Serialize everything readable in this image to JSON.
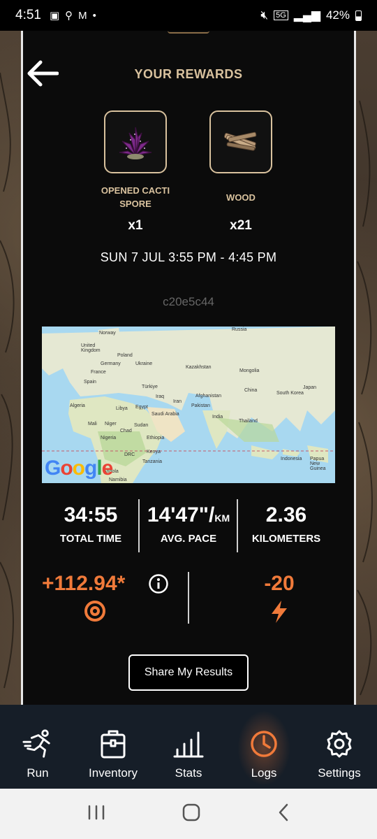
{
  "status_bar": {
    "time": "4:51",
    "battery": "42%",
    "network": "5G"
  },
  "header": {
    "title": "YOUR REWARDS"
  },
  "rewards": [
    {
      "name_line1": "OPENED CACTI",
      "name_line2": "SPORE",
      "quantity": "x1",
      "icon": "cacti-spore-icon"
    },
    {
      "name_line1": "WOOD",
      "name_line2": "",
      "quantity": "x21",
      "icon": "wood-icon"
    }
  ],
  "session": {
    "date_range": "SUN 7 JUL 3:55 PM - 4:45 PM",
    "id": "c20e5c44"
  },
  "map": {
    "labels": [
      "Russia",
      "Norway",
      "United Kingdom",
      "Poland",
      "Germany",
      "Ukraine",
      "France",
      "Spain",
      "Kazakhstan",
      "Mongolia",
      "Türkiye",
      "Iraq",
      "Iran",
      "Afghanistan",
      "Pakistan",
      "China",
      "South Korea",
      "Japan",
      "Algeria",
      "Libya",
      "Egypt",
      "Saudi Arabia",
      "India",
      "Thailand",
      "Mali",
      "Niger",
      "Chad",
      "Sudan",
      "Nigeria",
      "Ethiopia",
      "DRC",
      "Kenya",
      "Tanzania",
      "Angola",
      "Namibia",
      "Indonesia",
      "Papua New Guinea"
    ],
    "attribution": "Google"
  },
  "stats": {
    "total_time": {
      "value": "34:55",
      "label": "TOTAL TIME"
    },
    "avg_pace": {
      "value": "14'47\"/",
      "unit": "KM",
      "label": "AVG. PACE"
    },
    "distance": {
      "value": "2.36",
      "label": "KILOMETERS"
    }
  },
  "score": {
    "points": "+112.94*",
    "energy": "-20"
  },
  "share_button": "Share My Results",
  "nav": {
    "items": [
      {
        "label": "Run",
        "icon": "runner-icon"
      },
      {
        "label": "Inventory",
        "icon": "chest-icon"
      },
      {
        "label": "Stats",
        "icon": "bar-chart-icon"
      },
      {
        "label": "Logs",
        "icon": "clock-icon",
        "active": true
      },
      {
        "label": "Settings",
        "icon": "gear-icon"
      }
    ]
  },
  "colors": {
    "accent": "#f07a3a",
    "gold": "#d9c29e",
    "panel": "#0b0b0b",
    "nav_bg": "#161e28"
  }
}
